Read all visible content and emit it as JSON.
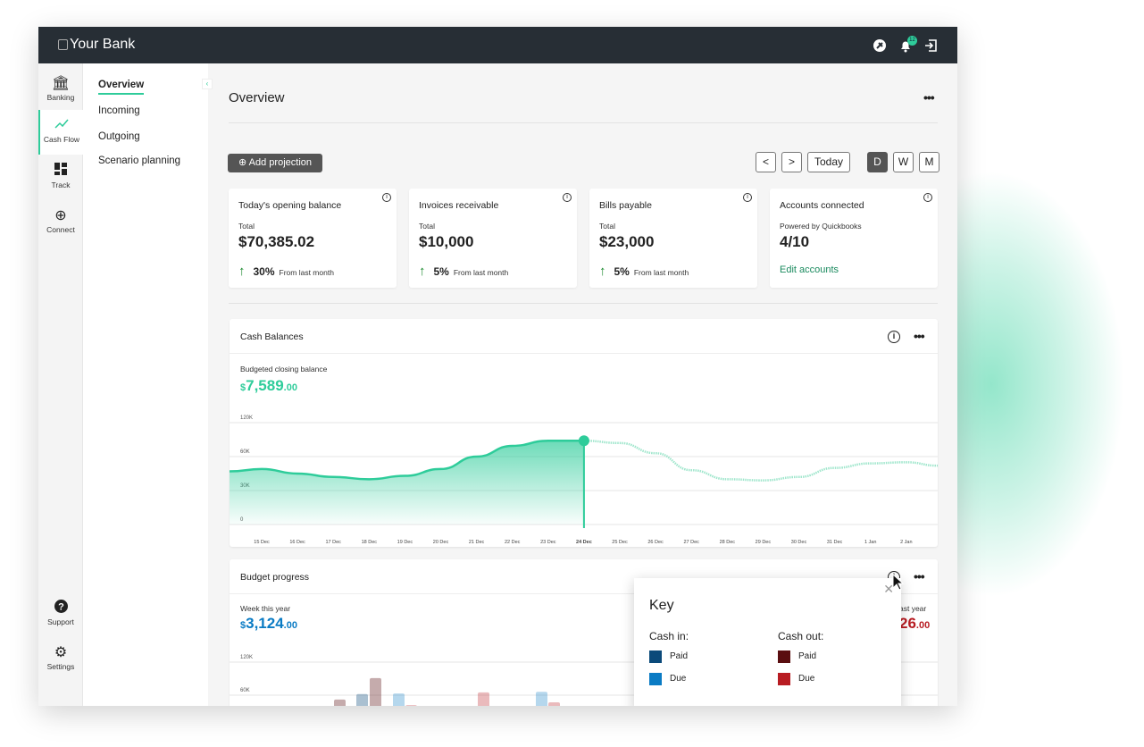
{
  "app": {
    "title": "Your Bank",
    "notification_count": "12",
    "icons": [
      "plug-icon",
      "bell-icon",
      "logout-icon"
    ]
  },
  "rail": [
    {
      "label": "Banking",
      "icon": "bank-icon"
    },
    {
      "label": "Cash Flow",
      "icon": "trend-icon",
      "active": true
    },
    {
      "label": "Track",
      "icon": "dashboard-icon"
    },
    {
      "label": "Connect",
      "icon": "plus-circle-icon"
    },
    {
      "label": "Support",
      "icon": "help-icon"
    },
    {
      "label": "Settings",
      "icon": "gear-icon"
    }
  ],
  "subnav": [
    {
      "label": "Overview",
      "active": true
    },
    {
      "label": "Incoming"
    },
    {
      "label": "Outgoing"
    },
    {
      "label": "Scenario planning"
    }
  ],
  "page": {
    "title": "Overview",
    "add_projection": "Add projection",
    "today": "Today",
    "prev": "<",
    "next": ">",
    "periods": [
      "D",
      "W",
      "M"
    ],
    "selected_period": "D"
  },
  "cards": [
    {
      "title": "Today's opening balance",
      "sub": "Total",
      "value": "$70,385.02",
      "change": "30%",
      "change_label": "From last month"
    },
    {
      "title": "Invoices receivable",
      "sub": "Total",
      "value": "$10,000",
      "change": "5%",
      "change_label": "From last month"
    },
    {
      "title": "Bills payable",
      "sub": "Total",
      "value": "$23,000",
      "change": "5%",
      "change_label": "From last month"
    },
    {
      "title": "Accounts connected",
      "sub": "Powered by Quickbooks",
      "value": "4/10",
      "link": "Edit accounts"
    }
  ],
  "cash_balances": {
    "title": "Cash Balances",
    "label": "Budgeted closing balance",
    "currency": "$",
    "amount": "7,589",
    "cents": ".00",
    "color": "#2ecc9a"
  },
  "chart_data": {
    "type": "area",
    "yticks": [
      "0",
      "30K",
      "60K",
      "120K"
    ],
    "ytick_values": [
      0,
      30000,
      60000,
      120000
    ],
    "categories": [
      "15 Dec",
      "16 Dec",
      "17 Dec",
      "18 Dec",
      "19 Dec",
      "20 Dec",
      "21 Dec",
      "22 Dec",
      "23 Dec",
      "24 Dec",
      "25 Dec",
      "26 Dec",
      "27 Dec",
      "28 Dec",
      "29 Dec",
      "30 Dec",
      "31 Dec",
      "1 Jan",
      "2 Jan"
    ],
    "values": [
      49000,
      45000,
      42000,
      40000,
      43000,
      49000,
      60000,
      79000,
      88000,
      88000,
      84000,
      66000,
      48000,
      40000,
      39000,
      42000,
      50000,
      54000,
      55000
    ],
    "current": "24 Dec",
    "grid": true
  },
  "budget": {
    "title": "Budget progress",
    "label": "Week this year",
    "currency": "$",
    "amount": "3,124",
    "cents": ".00",
    "color": "#0a7bc4",
    "right_label": "ast year",
    "right_amount": "26",
    "right_cents": ".00",
    "yticks": [
      "120K",
      "60K"
    ],
    "bars": [
      {
        "kind": "out-paid",
        "value": 52000
      },
      {
        "kind": "in-paid",
        "value": 62000
      },
      {
        "kind": "out-paid",
        "value": 91000
      },
      {
        "kind": "in-due",
        "value": 63000
      },
      {
        "kind": "out-due",
        "value": 42000
      },
      {
        "kind": "out-due",
        "value": 65000
      },
      {
        "kind": "in-due",
        "value": 66000
      },
      {
        "kind": "out-due",
        "value": 47000
      }
    ]
  },
  "key": {
    "title": "Key",
    "cash_in": "Cash in:",
    "cash_out": "Cash out:",
    "paid": "Paid",
    "due": "Due",
    "colors": {
      "in_paid": "#0b4a7a",
      "in_due": "#0a7bc4",
      "out_paid": "#5a0e10",
      "out_due": "#b81c22"
    }
  }
}
